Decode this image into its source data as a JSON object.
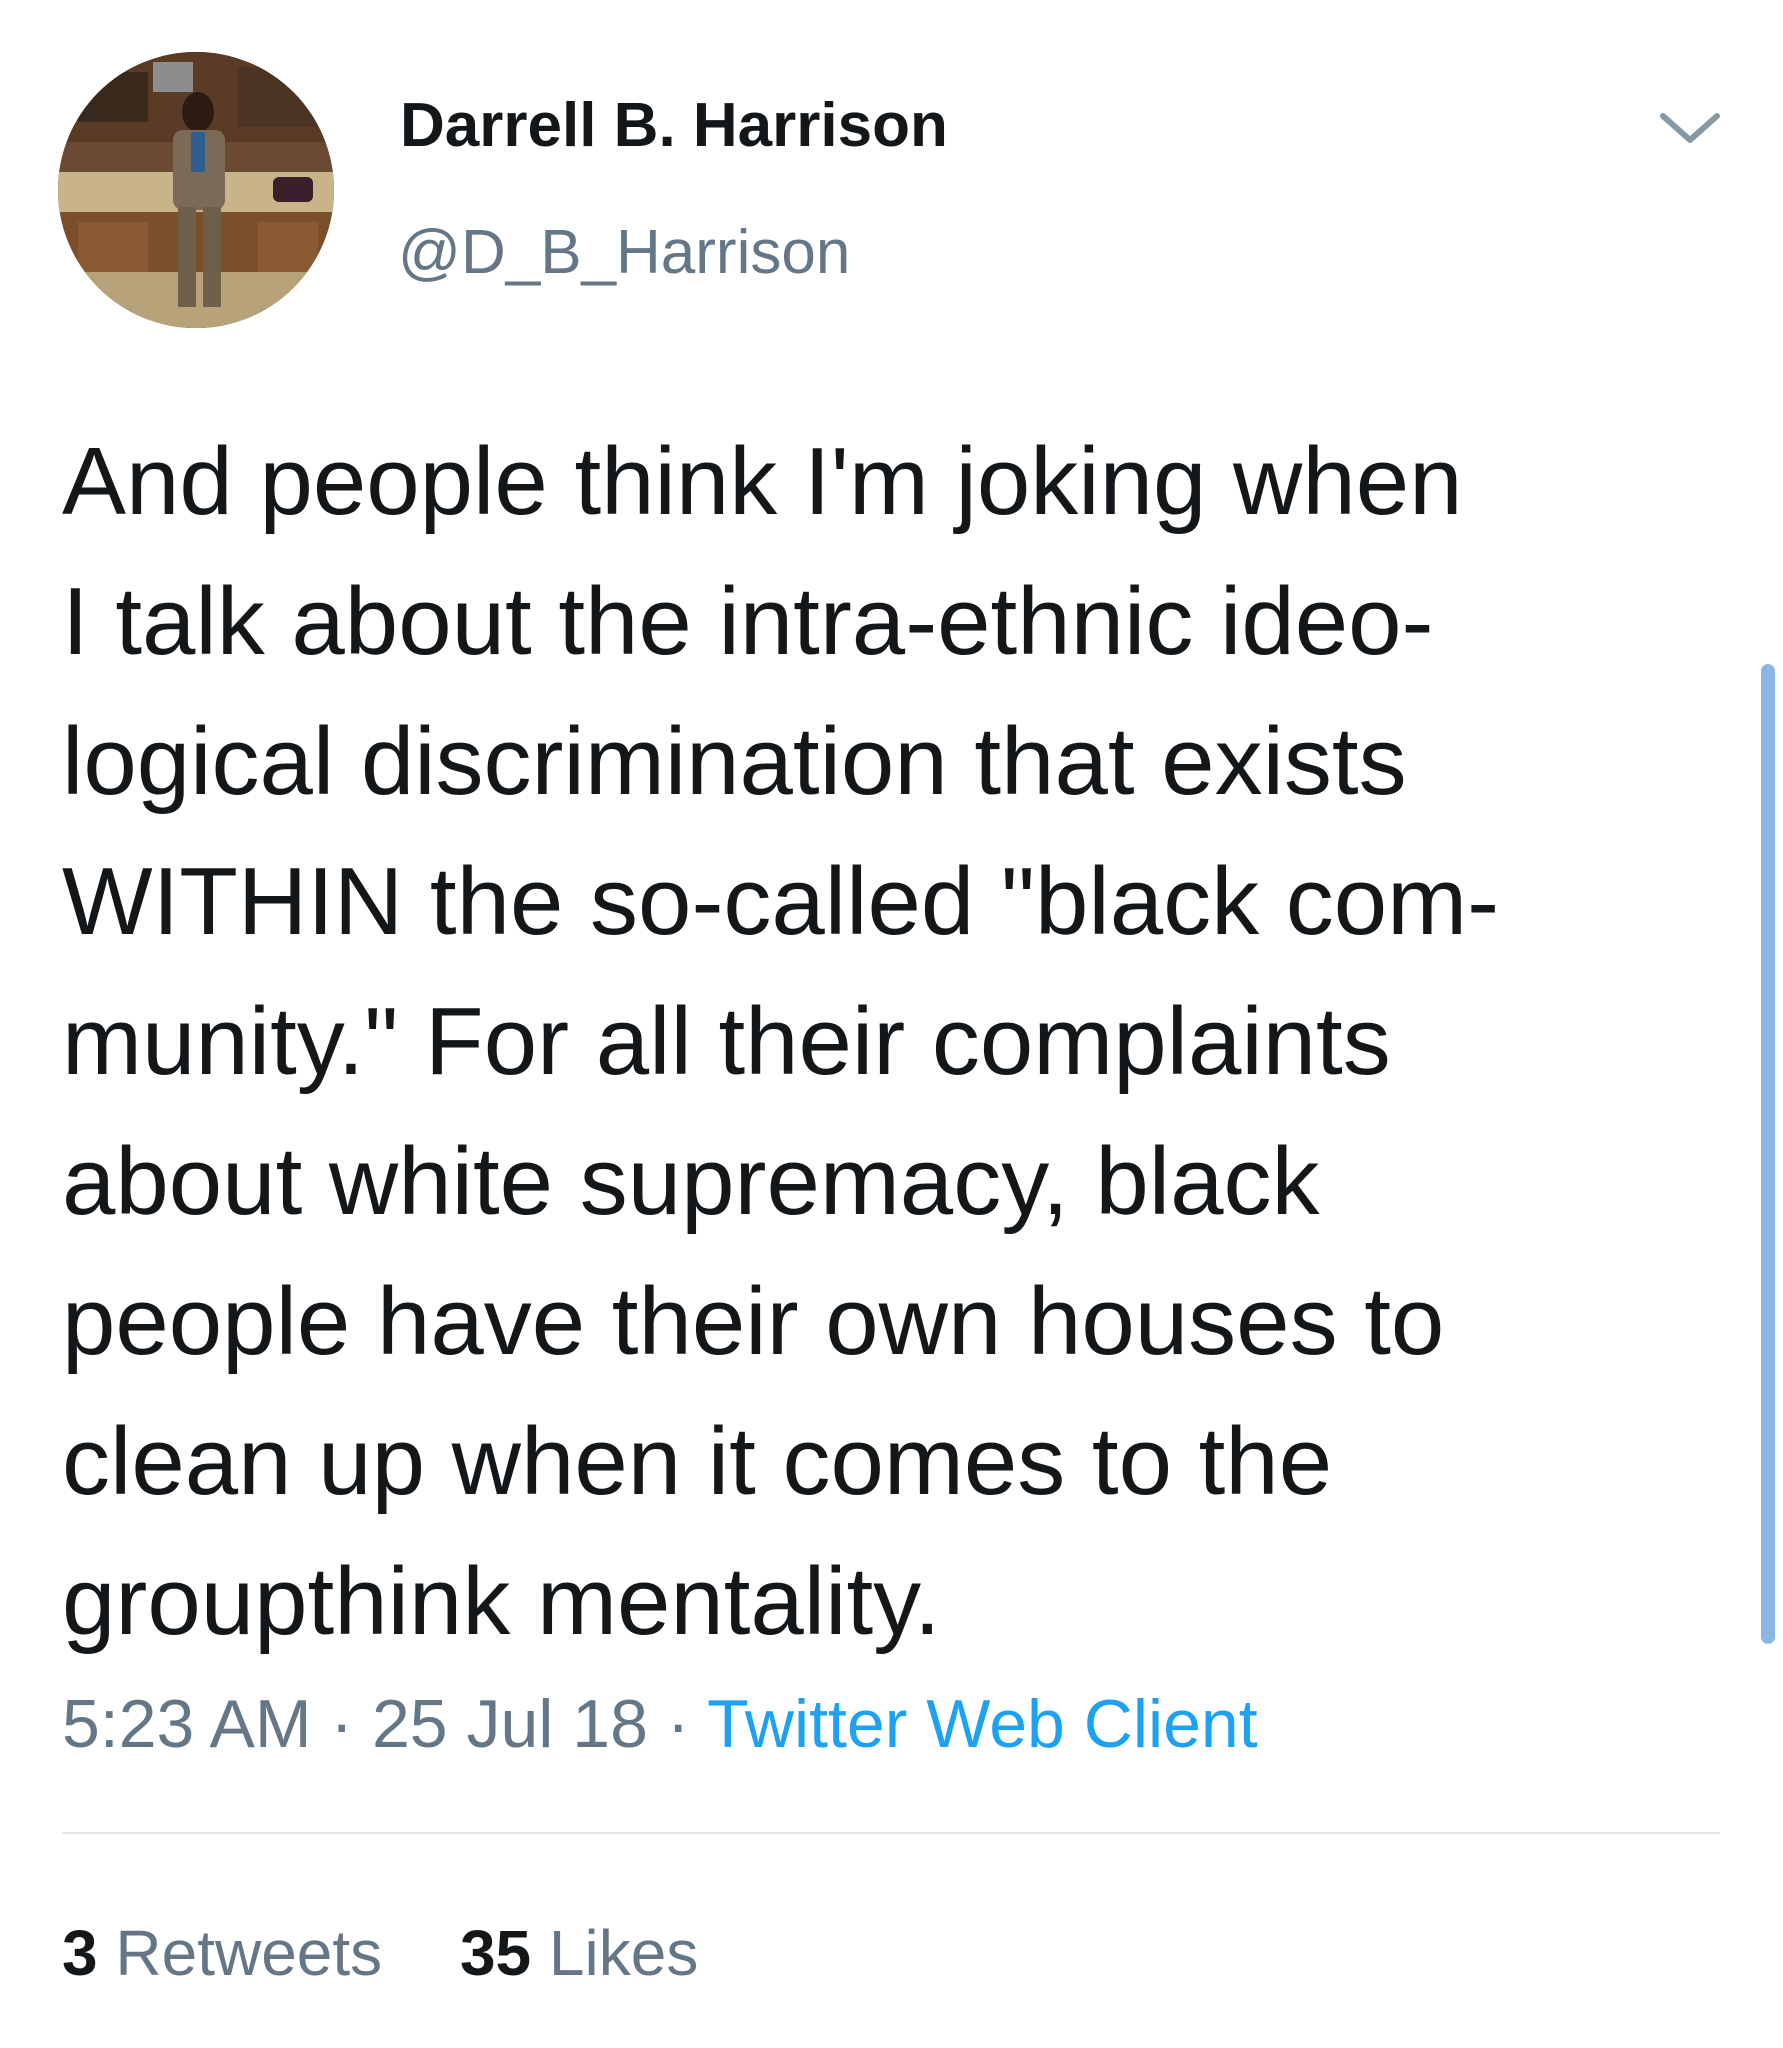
{
  "tweet": {
    "author": {
      "display_name": "Darrell B. Harrison",
      "handle": "@D_B_Harrison"
    },
    "text_lines": [
      "And people think I'm joking when",
      "I talk about the intra-ethnic ideo-",
      "logical discrimination that exists",
      "WITHIN the so-called \"black com-",
      "munity.\" For all their complaints",
      "about white supremacy, black",
      "people have their own houses to",
      "clean up when it comes to the",
      "groupthink mentality."
    ],
    "time": "5:23 AM",
    "date": "25 Jul 18",
    "separator": " · ",
    "source": "Twitter Web Client",
    "stats": {
      "retweets_count": "3",
      "retweets_label": " Retweets",
      "likes_count": "35",
      "likes_label": " Likes"
    }
  },
  "icons": {
    "menu": "chevron-down-icon"
  },
  "colors": {
    "text": "#14171a",
    "secondary_text": "#657786",
    "link": "#1da1f2",
    "divider": "#e1e8ed",
    "scrollbar": "#8ab7e4"
  }
}
